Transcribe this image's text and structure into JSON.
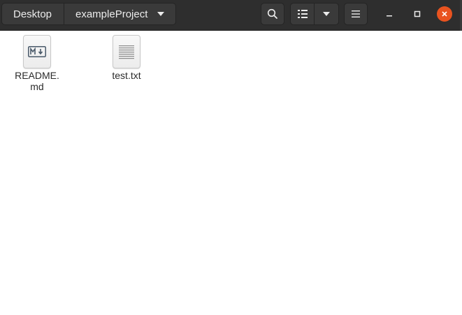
{
  "breadcrumb": {
    "items": [
      "Desktop",
      "exampleProject"
    ]
  },
  "files": [
    {
      "name": "README.md",
      "label_line1": "README.",
      "label_line2": "md",
      "icon": "markdown-file-icon"
    },
    {
      "name": "test.txt",
      "label_line1": "test.txt",
      "label_line2": "",
      "icon": "text-file-icon"
    }
  ],
  "toolbar": {
    "search_icon": "search-icon",
    "view_icon": "list-view-icon",
    "view_options_icon": "chevron-down-icon",
    "menu_icon": "hamburger-menu-icon"
  },
  "window_controls": {
    "minimize_icon": "minimize-icon",
    "maximize_icon": "maximize-icon",
    "close_icon": "close-icon",
    "close_color": "#e9531f"
  },
  "colors": {
    "headerbar": "#2e2e2e",
    "button": "#3a3a3a",
    "background": "#ffffff"
  }
}
